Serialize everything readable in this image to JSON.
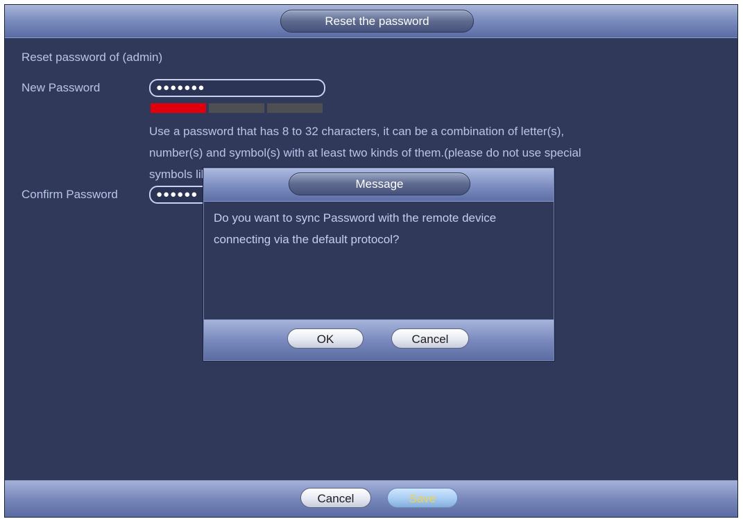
{
  "window": {
    "title": "Reset the password"
  },
  "form": {
    "reset_label": "Reset password of (admin)",
    "new_password_label": "New Password",
    "new_password_value": "●●●●●●●",
    "confirm_password_label": "Confirm Password",
    "confirm_password_value": "●●●●●●",
    "hint_line1": "Use a password that has 8 to 32 characters, it can be a combination of letter(s),",
    "hint_line2": "number(s) and symbol(s) with at least two kinds of them.(please do not use special",
    "hint_line3": "symbols like ' \" ; : &)",
    "strength": {
      "level": 1,
      "of": 3,
      "colors": [
        "#e0000b",
        "#4d4f52",
        "#4d4f52"
      ]
    }
  },
  "footer": {
    "cancel_label": "Cancel",
    "save_label": "Save"
  },
  "dialog": {
    "title": "Message",
    "message_line1": "Do you want to sync Password with the remote device",
    "message_line2": "connecting via the default protocol?",
    "ok_label": "OK",
    "cancel_label": "Cancel"
  },
  "colors": {
    "background": "#30395a",
    "text": "#b8c4e8",
    "save_text": "#f2d24a",
    "strength_weak": "#e0000b"
  }
}
